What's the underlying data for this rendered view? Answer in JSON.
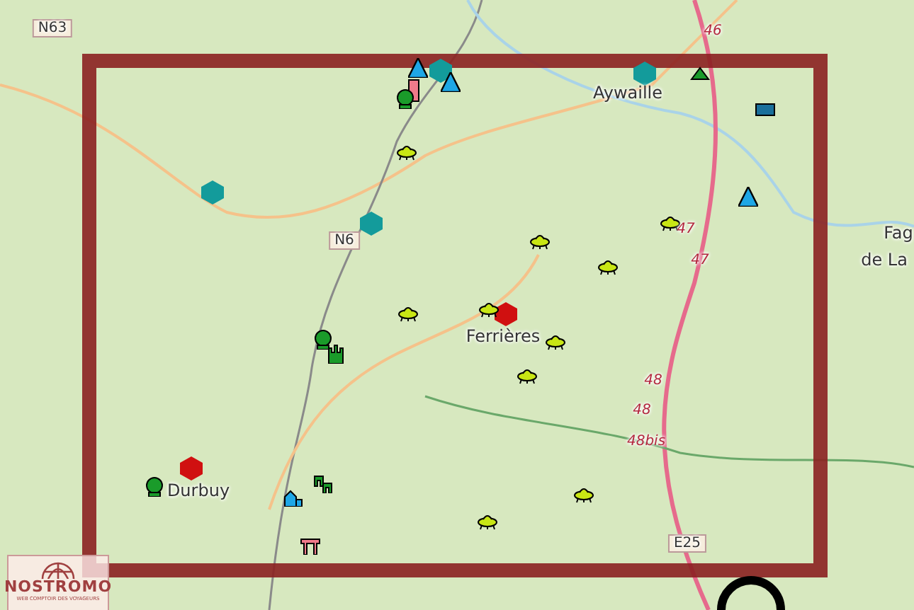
{
  "map": {
    "labels": [
      {
        "kind": "road",
        "text": "N63"
      },
      {
        "kind": "exit",
        "text": "46"
      },
      {
        "kind": "exit",
        "text": "47"
      },
      {
        "kind": "exit",
        "text": "47"
      },
      {
        "kind": "road",
        "text": "N6"
      },
      {
        "kind": "town",
        "text": "Aywaille"
      },
      {
        "kind": "town",
        "text": "Ferrières"
      },
      {
        "kind": "town",
        "text": "Durbuy"
      },
      {
        "kind": "exit",
        "text": "48"
      },
      {
        "kind": "exit",
        "text": "48"
      },
      {
        "kind": "exit",
        "text": "48bis"
      },
      {
        "kind": "road",
        "text": "E25"
      },
      {
        "kind": "town",
        "text": "Fag"
      },
      {
        "kind": "town",
        "text": "de La"
      }
    ],
    "markers": [
      {
        "kind": "hexagon",
        "color": "#139b9b"
      },
      {
        "kind": "hexagon",
        "color": "#139b9b"
      },
      {
        "kind": "hexagon",
        "color": "#139b9b"
      },
      {
        "kind": "hexagon",
        "color": "#139b9b"
      },
      {
        "kind": "hexagon",
        "color": "#d01010"
      },
      {
        "kind": "hexagon",
        "color": "#d01010"
      },
      {
        "kind": "tent"
      },
      {
        "kind": "tent"
      },
      {
        "kind": "tent"
      },
      {
        "kind": "flag"
      },
      {
        "kind": "tree"
      },
      {
        "kind": "tree"
      },
      {
        "kind": "tree"
      },
      {
        "kind": "ufo"
      },
      {
        "kind": "ufo"
      },
      {
        "kind": "ufo"
      },
      {
        "kind": "ufo"
      },
      {
        "kind": "ufo"
      },
      {
        "kind": "ufo"
      },
      {
        "kind": "ufo"
      },
      {
        "kind": "ufo"
      },
      {
        "kind": "ufo"
      },
      {
        "kind": "ufo"
      },
      {
        "kind": "castle"
      },
      {
        "kind": "house"
      },
      {
        "kind": "ruin"
      },
      {
        "kind": "gate"
      },
      {
        "kind": "hut"
      },
      {
        "kind": "wagon"
      }
    ],
    "logo": {
      "name": "NOSTROMO",
      "tagline": "WEB COMPTOIR DES VOYAGEURS"
    }
  }
}
